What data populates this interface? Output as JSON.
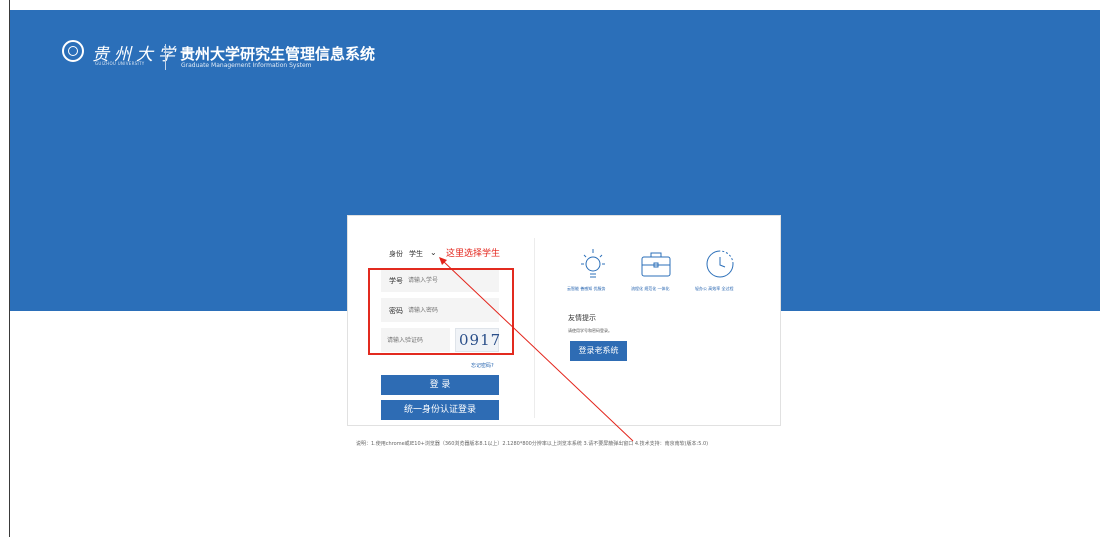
{
  "header": {
    "logo_cn": "贵州大学",
    "logo_en": "GUIZHOU UNIVERSITY",
    "title": "贵州大学研究生管理信息系统",
    "subtitle": "Graduate Management Information System"
  },
  "login": {
    "identity_label": "身份",
    "identity_value": "学生",
    "annotation": "这里选择学生",
    "student_id_label": "学号",
    "student_id_placeholder": "请输入学号",
    "password_label": "密码",
    "password_placeholder": "请输入密码",
    "captcha_placeholder": "请输入验证码",
    "captcha_code": "0917",
    "forgot": "忘记密码?",
    "login_button": "登 录",
    "sso_button": "统一身份认证登录"
  },
  "features": [
    {
      "icon": "lightbulb-icon",
      "label": "云智能 善感知 优服务"
    },
    {
      "icon": "briefcase-icon",
      "label": "流程化 规范化 一体化"
    },
    {
      "icon": "clock-icon",
      "label": "轻办公 高效率 全过程"
    }
  ],
  "tips": {
    "title": "友情提示",
    "text": "请使用学号和密码登录。",
    "old_system_button": "登录老系统"
  },
  "footer": "说明：1.使用chrome或IE10+浏览器（360浏览器版本8.1以上）2.1280*800分辨率以上浏览本系统 3.请不要屏蔽弹出窗口 4.技术支持：南京南软(版本:5.0)",
  "colors": {
    "brand_blue": "#2b6fb9",
    "button_blue": "#2e6cb4",
    "annotation_red": "#e3241b"
  }
}
